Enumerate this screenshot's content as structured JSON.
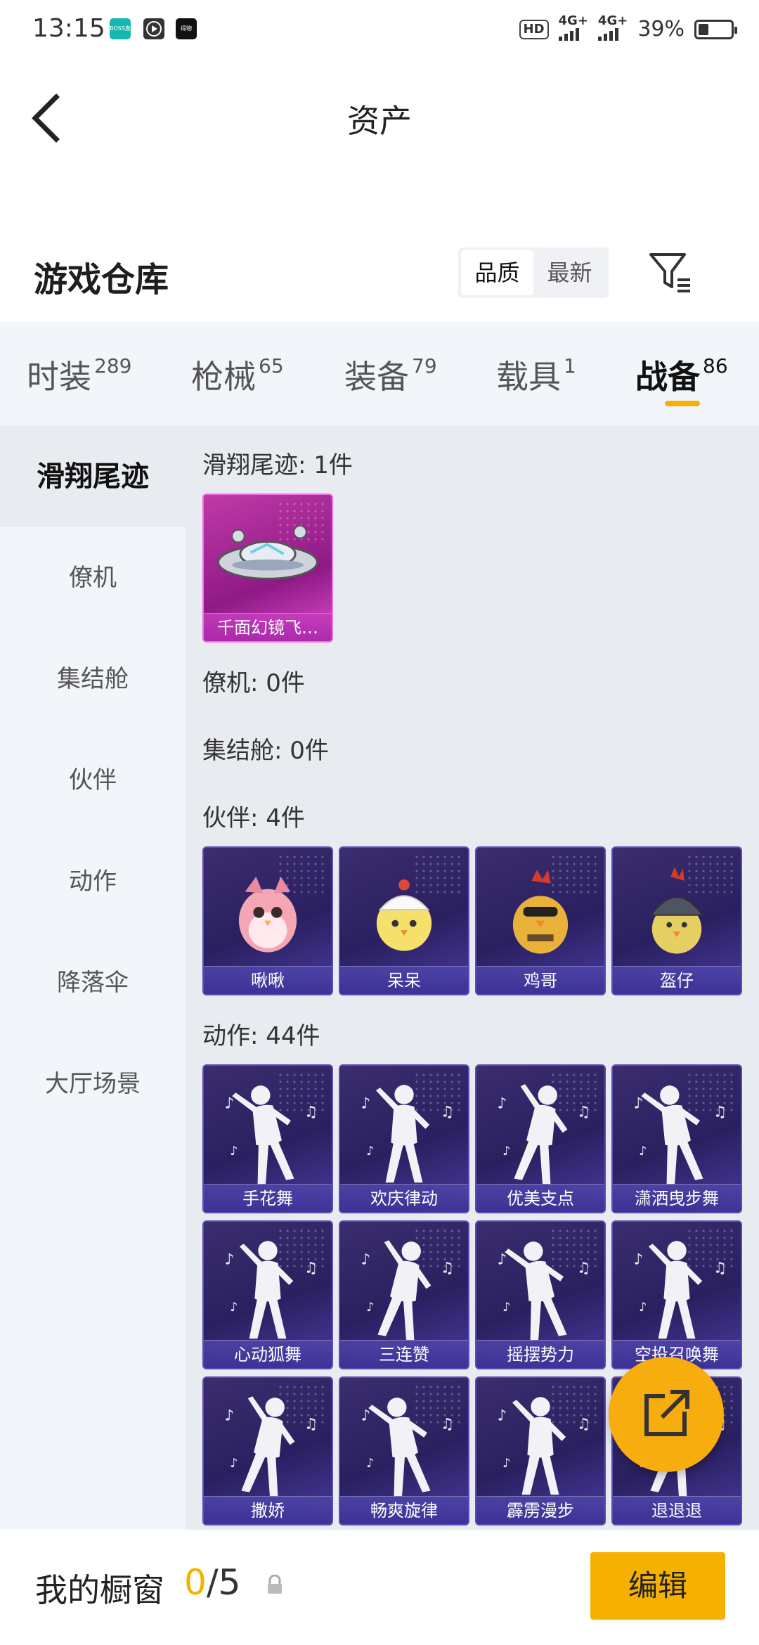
{
  "status_bar": {
    "time": "13:15",
    "apps": [
      "BOSS直聘",
      "video",
      "得物"
    ],
    "hd_label": "HD",
    "signal_1": "4G+",
    "signal_2": "4G+",
    "battery": "39%"
  },
  "header": {
    "title": "资产"
  },
  "warehouse": {
    "title": "游戏仓库",
    "sort_options": [
      "品质",
      "最新"
    ],
    "active_sort": "品质"
  },
  "tabs": [
    {
      "label": "时装",
      "count": "289"
    },
    {
      "label": "枪械",
      "count": "65"
    },
    {
      "label": "装备",
      "count": "79"
    },
    {
      "label": "载具",
      "count": "1"
    },
    {
      "label": "战备",
      "count": "86",
      "active": true
    }
  ],
  "sidebar": {
    "items": [
      "滑翔尾迹",
      "僚机",
      "集结舱",
      "伙伴",
      "动作",
      "降落伞",
      "大厅场景"
    ],
    "active": "滑翔尾迹"
  },
  "sections": {
    "glide": {
      "title": "滑翔尾迹: 1件",
      "items": [
        "千面幻镜飞…"
      ]
    },
    "wingman": {
      "title": "僚机: 0件"
    },
    "pod": {
      "title": "集结舱: 0件"
    },
    "partner": {
      "title": "伙伴: 4件",
      "items": [
        "啾啾",
        "呆呆",
        "鸡哥",
        "盔仔"
      ]
    },
    "emote": {
      "title": "动作: 44件",
      "items": [
        "手花舞",
        "欢庆律动",
        "优美支点",
        "潇洒曳步舞",
        "心动狐舞",
        "三连赞",
        "摇摆势力",
        "空投召唤舞",
        "撒娇",
        "畅爽旋律",
        "霹雳漫步",
        "退退退"
      ]
    }
  },
  "bottom": {
    "title": "我的橱窗",
    "count_current": "0",
    "count_total": "/5",
    "edit_label": "编辑"
  },
  "colors": {
    "accent": "#f5b100",
    "card_bg": "#2f2566",
    "card_pink": "#b0309f"
  }
}
